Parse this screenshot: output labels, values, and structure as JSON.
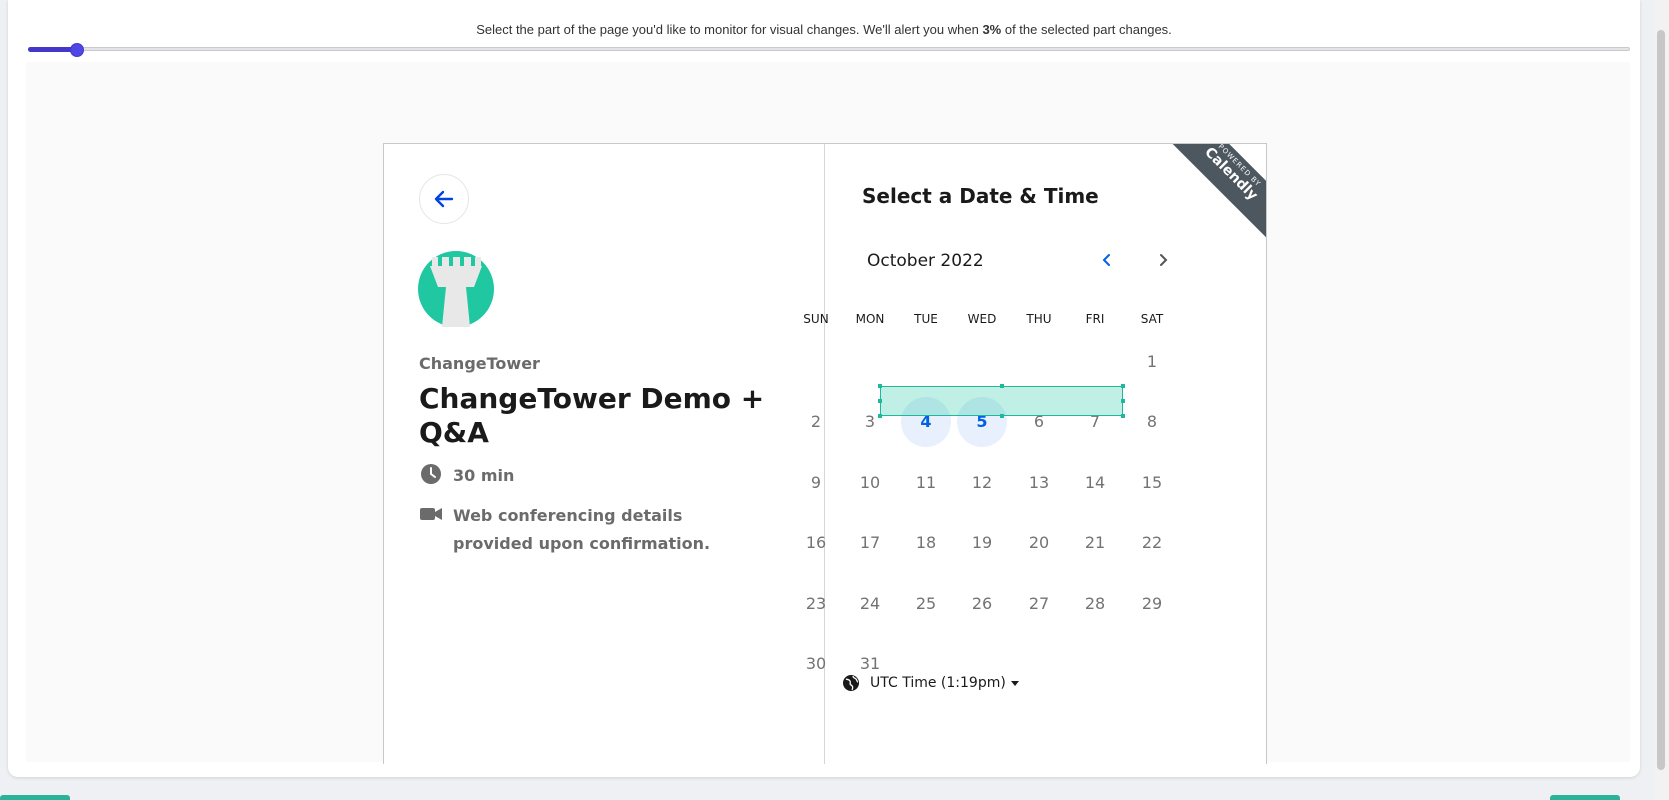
{
  "instruction": {
    "before": "Select the part of the page you'd like to monitor for visual changes. We'll alert you when ",
    "percent": "3%",
    "after": " of the selected part changes."
  },
  "slider": {
    "value_percent": 3,
    "accent": "#4f46e5"
  },
  "card": {
    "back_icon": "arrow-left-icon",
    "org_name": "ChangeTower",
    "event_title": "ChangeTower Demo + Q&A",
    "duration": "30 min",
    "conferencing": "Web conferencing details provided upon confirmation.",
    "heading": "Select a Date & Time",
    "month": "October 2022",
    "ribbon_small": "POWERED BY",
    "ribbon_big": "Calendly",
    "weekdays": [
      "SUN",
      "MON",
      "TUE",
      "WED",
      "THU",
      "FRI",
      "SAT"
    ],
    "weeks": [
      [
        "",
        "",
        "",
        "",
        "",
        "",
        "1"
      ],
      [
        "2",
        "3",
        "4",
        "5",
        "6",
        "7",
        "8"
      ],
      [
        "9",
        "10",
        "11",
        "12",
        "13",
        "14",
        "15"
      ],
      [
        "16",
        "17",
        "18",
        "19",
        "20",
        "21",
        "22"
      ],
      [
        "23",
        "24",
        "25",
        "26",
        "27",
        "28",
        "29"
      ],
      [
        "30",
        "31",
        "",
        "",
        "",
        "",
        ""
      ]
    ],
    "available_days": [
      "4",
      "5"
    ],
    "timezone": "UTC Time (1:19pm)",
    "colors": {
      "brand_teal": "#1fc8a0",
      "available_blue": "#0060e6",
      "selection": "#1db99a"
    }
  }
}
